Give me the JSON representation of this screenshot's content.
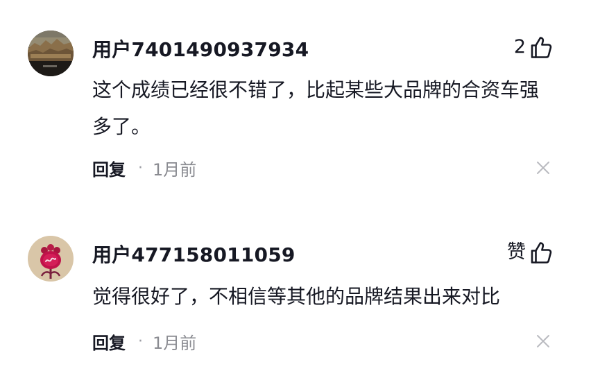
{
  "comments": [
    {
      "username": "用户7401490937934",
      "like_label": "2",
      "content": "这个成绩已经很不错了，比起某些大品牌的合资车强多了。",
      "reply_label": "回复",
      "separator": "·",
      "time": "1月前",
      "avatar_icon": "landscape-photo-avatar",
      "like_icon": "thumbs-up-icon",
      "close_icon": "close-icon"
    },
    {
      "username": "用户477158011059",
      "like_label": "赞",
      "content": "觉得很好了，不相信等其他的品牌结果出来对比",
      "reply_label": "回复",
      "separator": "·",
      "time": "1月前",
      "avatar_icon": "red-flower-avatar",
      "like_icon": "thumbs-up-icon",
      "close_icon": "close-icon"
    }
  ],
  "colors": {
    "text_primary": "#161823",
    "text_secondary": "#8a8b91",
    "close_icon": "#b9bac0",
    "background": "#ffffff"
  }
}
